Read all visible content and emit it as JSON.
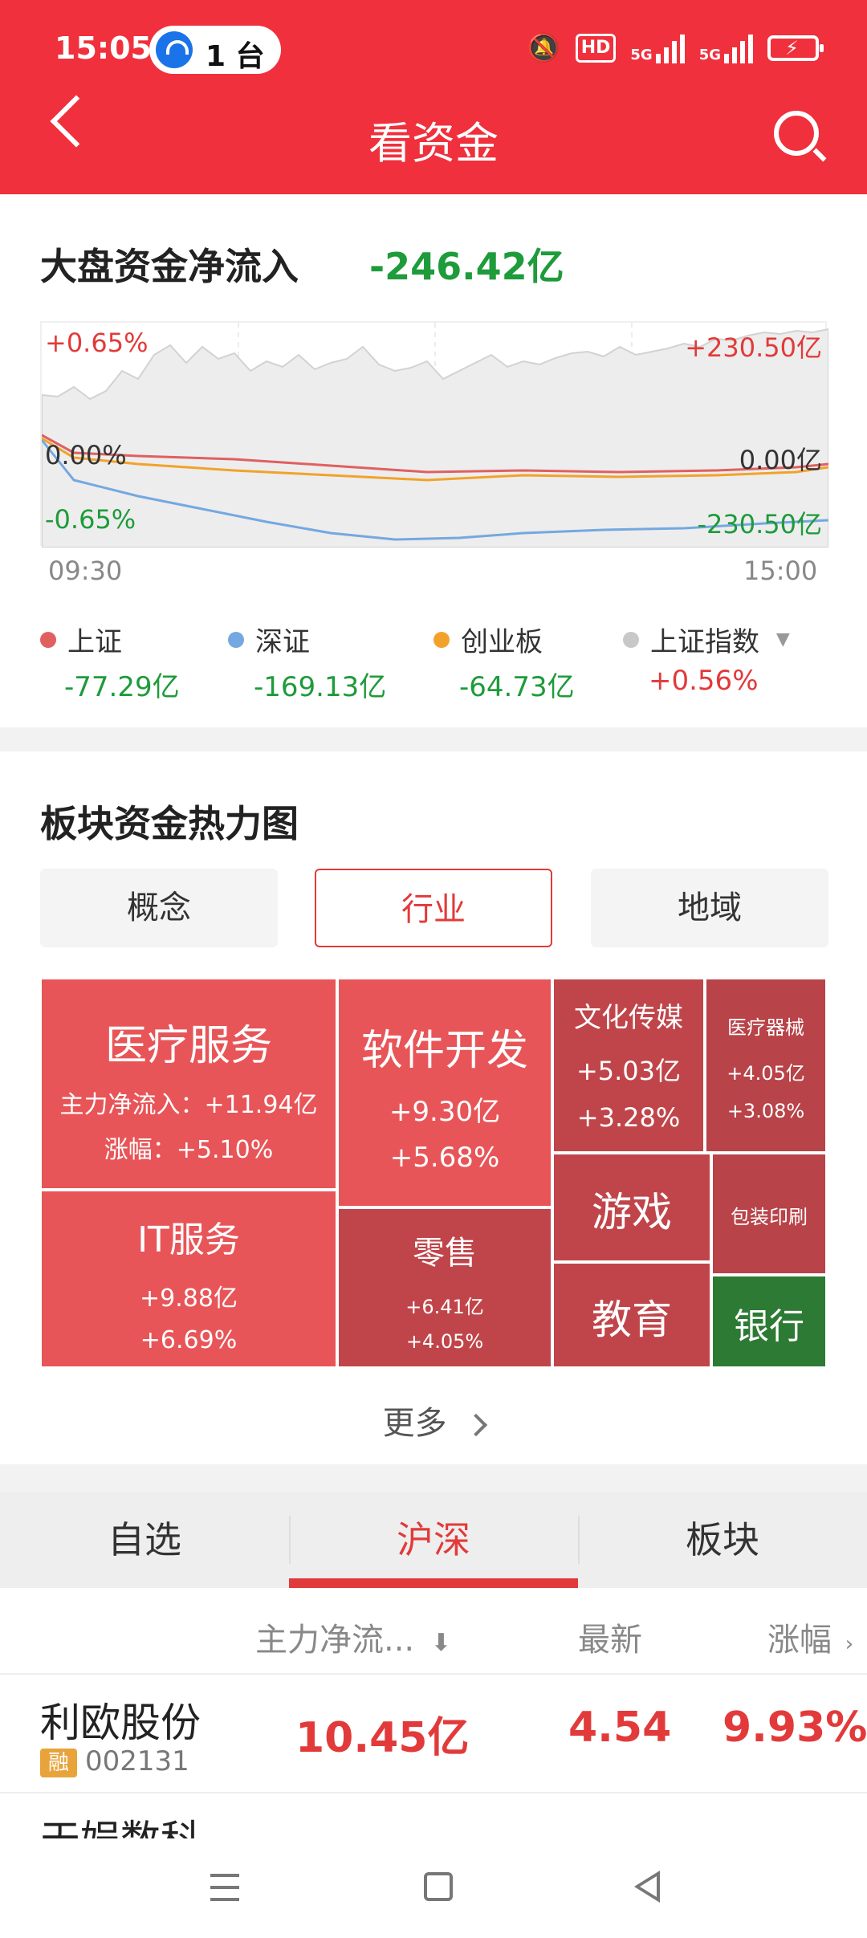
{
  "status": {
    "time": "15:05",
    "pill_text": "1 台",
    "hd": "HD",
    "net1": "5G",
    "net2": "5G"
  },
  "header": {
    "title": "看资金"
  },
  "market": {
    "title": "大盘资金净流入",
    "value": "-246.42亿",
    "chart": {
      "left_top": "+0.65%",
      "left_mid": "0.00%",
      "left_bot": "-0.65%",
      "right_top": "+230.50亿",
      "right_mid": "0.00亿",
      "right_bot": "-230.50亿",
      "t_start": "09:30",
      "t_end": "15:00"
    },
    "legend": [
      {
        "name": "上证",
        "value": "-77.29亿",
        "color": "#e06060"
      },
      {
        "name": "深证",
        "value": "-169.13亿",
        "color": "#74a8e0"
      },
      {
        "name": "创业板",
        "value": "-64.73亿",
        "color": "#f2a22a"
      },
      {
        "name": "上证指数",
        "value": "+0.56%",
        "color": "#c8c8c8"
      }
    ]
  },
  "heatmap": {
    "title": "板块资金热力图",
    "tabs": [
      "概念",
      "行业",
      "地域"
    ],
    "tiles": {
      "t1": {
        "name": "医疗服务",
        "line1": "主力净流入：+11.94亿",
        "line2": "涨幅：+5.10%"
      },
      "t2": {
        "name": "软件开发",
        "line1": "+9.30亿",
        "line2": "+5.68%"
      },
      "t3": {
        "name": "文化传媒",
        "line1": "+5.03亿",
        "line2": "+3.28%"
      },
      "t4": {
        "name": "医疗器械",
        "line1": "+4.05亿",
        "line2": "+3.08%"
      },
      "t5": {
        "name": "IT服务",
        "line1": "+9.88亿",
        "line2": "+6.69%"
      },
      "t6": {
        "name": "零售",
        "line1": "+6.41亿",
        "line2": "+4.05%"
      },
      "t7": {
        "name": "游戏"
      },
      "t8": {
        "name": "包装印刷"
      },
      "t9": {
        "name": "教育"
      },
      "t10": {
        "name": "银行"
      }
    },
    "more": "更多"
  },
  "list": {
    "tabs": [
      "自选",
      "沪深",
      "板块"
    ],
    "headers": {
      "flow": "主力净流...",
      "latest": "最新",
      "change": "涨幅"
    },
    "row": {
      "name": "利欧股份",
      "tag": "融",
      "code": "002131",
      "flow": "10.45亿",
      "latest": "4.54",
      "change": "9.93%"
    },
    "next_row_partial": "天娱数科"
  }
}
